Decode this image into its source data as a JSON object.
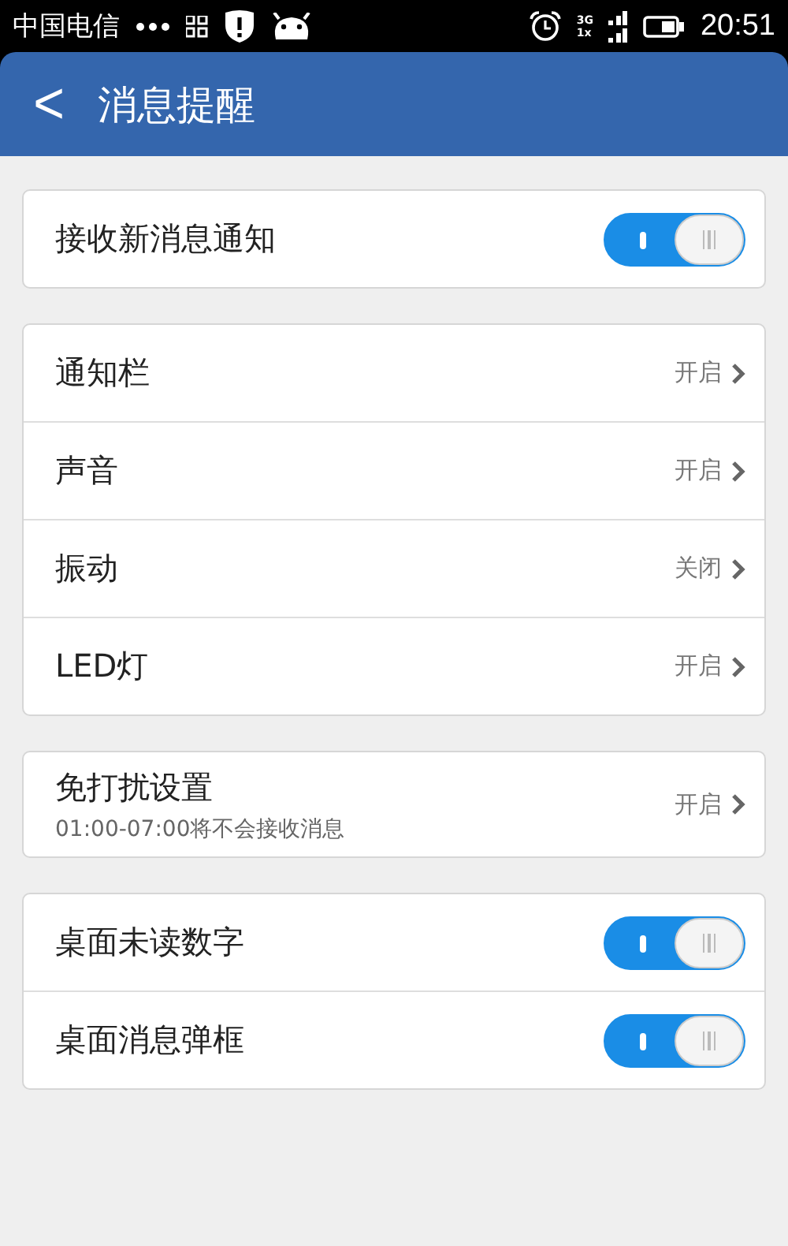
{
  "status_bar": {
    "carrier": "中国电信",
    "network_top": "3G",
    "network_bottom": "1x",
    "time": "20:51"
  },
  "header": {
    "back": "<",
    "title": "消息提醒"
  },
  "groups": [
    {
      "items": [
        {
          "kind": "toggle",
          "label": "接收新消息通知",
          "on": true
        }
      ]
    },
    {
      "items": [
        {
          "kind": "link",
          "label": "通知栏",
          "value": "开启"
        },
        {
          "kind": "link",
          "label": "声音",
          "value": "开启"
        },
        {
          "kind": "link",
          "label": "振动",
          "value": "关闭"
        },
        {
          "kind": "link",
          "label": "LED灯",
          "value": "开启"
        }
      ]
    },
    {
      "items": [
        {
          "kind": "link",
          "label": "免打扰设置",
          "subtitle": "01:00-07:00将不会接收消息",
          "value": "开启"
        }
      ]
    },
    {
      "items": [
        {
          "kind": "toggle",
          "label": "桌面未读数字",
          "on": true
        },
        {
          "kind": "toggle",
          "label": "桌面消息弹框",
          "on": true
        }
      ]
    }
  ]
}
